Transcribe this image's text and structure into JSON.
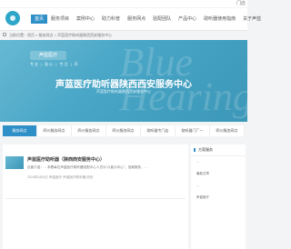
{
  "topbar": {
    "right_text": "门店"
  },
  "nav": {
    "items": [
      "首页",
      "服务项目",
      "案例中心",
      "助力科普",
      "服务网点",
      "验配团队",
      "产品中心",
      "助听器使用指南",
      "关于声蓝"
    ],
    "active_index": 0
  },
  "breadcrumb": {
    "text": "当前位置：首页 > 服务网点 > 声蓝医疗助听器陕西西安服务中心"
  },
  "banner": {
    "logo_text": "声蓝医疗",
    "tagline": "专业 | 贴心 | 专注 | 声",
    "title": "声蓝医疗助听器陕西西安服务中心",
    "subtitle": "声蓝医疗助听器陕西西安服务中心",
    "watermark": "Blue\nHearing"
  },
  "tabs": {
    "items": [
      "服务网点",
      "四川服务网点",
      "四川服务网点",
      "四川服务网点",
      "助听器专门店",
      "助听器门厂一",
      "四川服务网点"
    ],
    "active_index": 0
  },
  "article": {
    "title": "声蓝医疗助听器（陕西西安服务中心）",
    "desc": "店面介绍：... 本着每位声蓝医疗助听器验配中心人员为\"以客为中心\"，信赖服务，...",
    "meta": "2024年4月4日  声蓝医疗  声蓝医疗助听器  西安"
  },
  "sidebar": {
    "heading": "方案服务",
    "items": [
      "...",
      "最新文章",
      "...",
      "声蓝医疗"
    ]
  }
}
